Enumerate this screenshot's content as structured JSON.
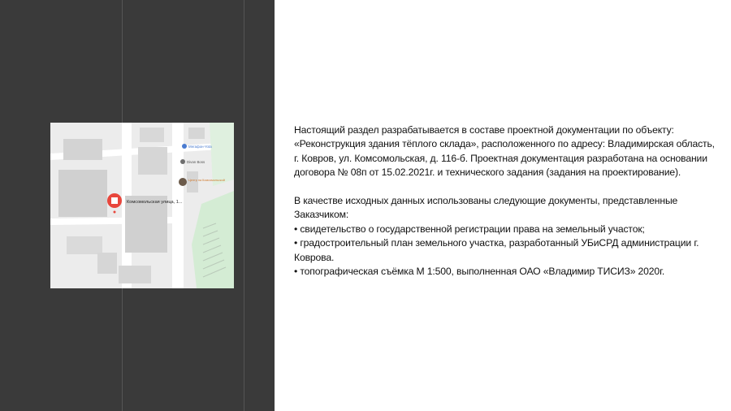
{
  "map": {
    "pin_label": "Комсомольская улица, 1...",
    "poi": [
      "Мегафон-Yota",
      "Divan Boss",
      "Центр на Комсомольской"
    ]
  },
  "text": {
    "paragraph1": "Настоящий раздел разрабатывается в составе проектной документации по объекту: «Реконструкция здания тёплого склада», расположенного по адресу: Владимирская область, г. Ковров, ул. Комсомольская, д. 116-б. Проектная документация разработана на основании договора № 08п от 15.02.2021г. и технического задания (задания на проектирование).",
    "paragraph2_intro": "В качестве исходных данных использованы следующие документы, представленные Заказчиком:",
    "bullets": [
      "• свидетельство о государственной регистрации права на земельный участок;",
      "• градостроительный план земельного участка, разработанный УБиСРД администрации г. Коврова.",
      "• топографическая съёмка М 1:500, выполненная ОАО «Владимир ТИСИЗ» 2020г."
    ]
  }
}
